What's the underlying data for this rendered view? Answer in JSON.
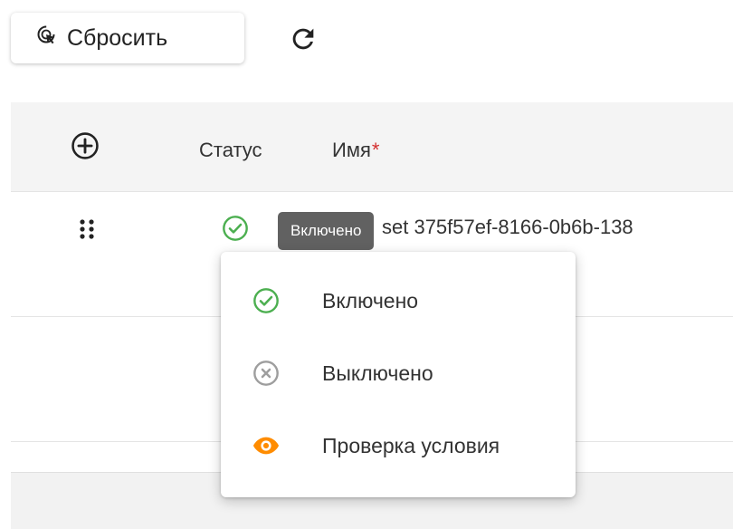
{
  "toolbar": {
    "reset_label": "Сбросить",
    "reset_icon": "cursor-reset-icon",
    "refresh_icon": "refresh-icon"
  },
  "table": {
    "add_column_icon": "plus-circle-icon",
    "headers": {
      "status": "Статус",
      "name": "Имя",
      "required_marker": "*"
    },
    "rows": [
      {
        "status": "enabled",
        "name": "set 375f57ef-8166-0b6b-138"
      },
      {
        "status": "",
        "name": ""
      }
    ]
  },
  "tooltip": {
    "text": "Включено"
  },
  "status_menu": {
    "items": [
      {
        "label": "Включено",
        "icon": "check-circle-icon",
        "color": "#4caf50"
      },
      {
        "label": "Выключено",
        "icon": "x-circle-icon",
        "color": "#9e9e9e"
      },
      {
        "label": "Проверка условия",
        "icon": "eye-icon",
        "color": "#ff8c00"
      }
    ]
  },
  "colors": {
    "enabled": "#4caf50",
    "disabled": "#9e9e9e",
    "condition": "#ff8c00",
    "required": "#d32f2f",
    "header_bg": "#f4f4f4",
    "tooltip_bg": "#616161"
  }
}
